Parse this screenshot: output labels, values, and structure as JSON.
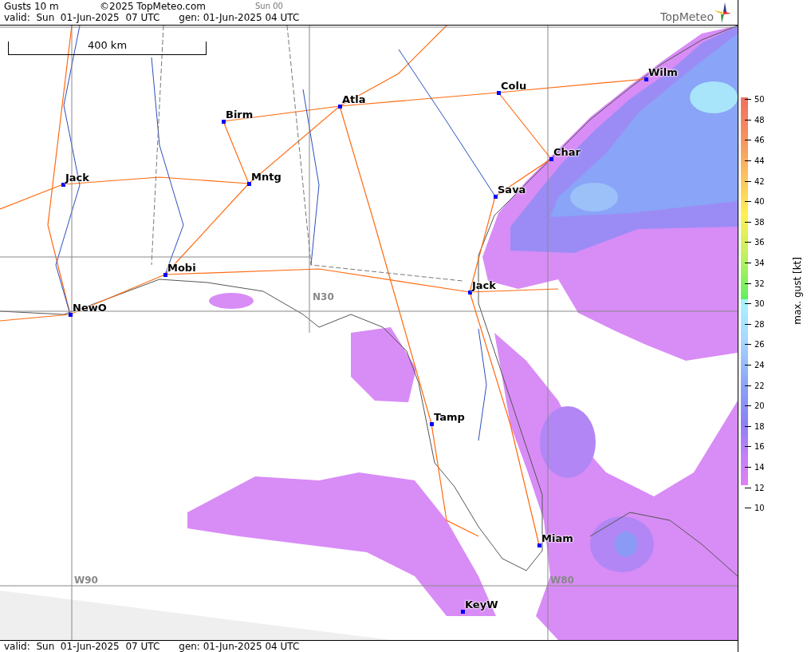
{
  "header": {
    "title": "Gusts 10 m",
    "copyright": "©2025 TopMeteo.com",
    "run": "Sun 00",
    "valid": "valid:  Sun  01-Jun-2025  07 UTC",
    "generated": "gen: 01-Jun-2025 04 UTC"
  },
  "logo": {
    "text": "TopMeteo"
  },
  "map": {
    "scale": "400 km",
    "grid_labels": [
      "N30",
      "W90",
      "W80"
    ],
    "cities": [
      "Birm",
      "Atla",
      "Colu",
      "Wilm",
      "Char",
      "Sava",
      "Mntg",
      "Jack",
      "Mobi",
      "NewO",
      "Jack",
      "Tamp",
      "Miam",
      "KeyW"
    ]
  },
  "legend": {
    "title": "max. gust [kt]",
    "ticks": [
      "50",
      "48",
      "46",
      "44",
      "42",
      "40",
      "38",
      "36",
      "34",
      "32",
      "30",
      "28",
      "26",
      "24",
      "22",
      "20",
      "18",
      "16",
      "14",
      "12",
      "10"
    ]
  },
  "footer": {
    "valid": "valid:  Sun  01-Jun-2025  07 UTC",
    "generated": "gen: 01-Jun-2025 04 UTC"
  }
}
